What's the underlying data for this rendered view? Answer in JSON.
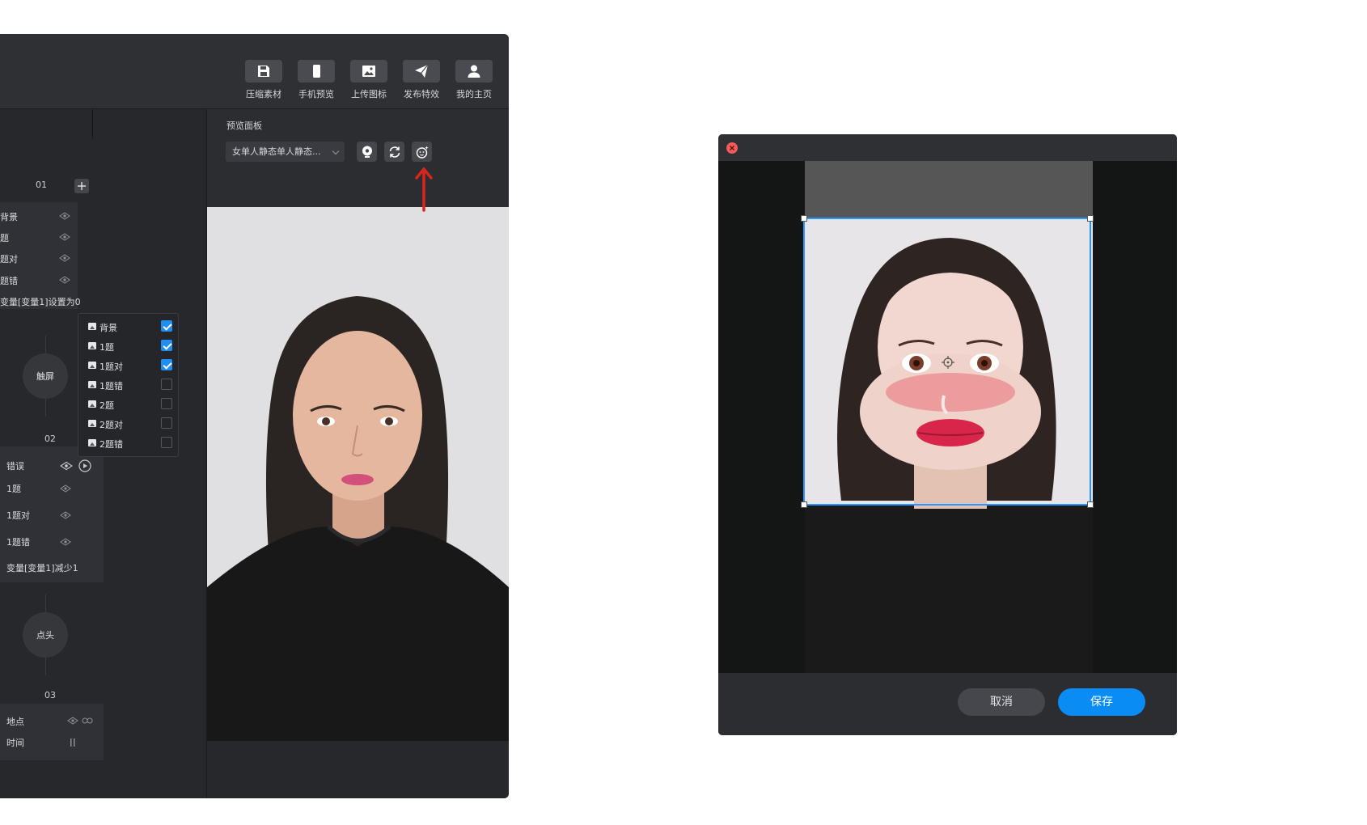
{
  "toolbar": {
    "items": [
      {
        "label": "压缩素材",
        "icon": "save-icon"
      },
      {
        "label": "手机预览",
        "icon": "phone-icon"
      },
      {
        "label": "上传图标",
        "icon": "image-upload-icon"
      },
      {
        "label": "发布特效",
        "icon": "send-icon"
      },
      {
        "label": "我的主页",
        "icon": "user-icon"
      }
    ]
  },
  "timeline": {
    "step1": {
      "number": "01",
      "rows": [
        "背景",
        "题",
        "题对",
        "题错",
        "变量[变量1]设置为0"
      ]
    },
    "trigger1": "触屏",
    "step2": {
      "number": "02",
      "rows": [
        "错误",
        "1题",
        "1题对",
        "1题错",
        "变量[变量1]减少1"
      ]
    },
    "trigger2": "点头",
    "step3": {
      "number": "03",
      "rows": [
        "地点",
        "时间"
      ]
    }
  },
  "layer_popup": {
    "items": [
      {
        "label": "背景",
        "checked": true
      },
      {
        "label": "1题",
        "checked": true
      },
      {
        "label": "1题对",
        "checked": true
      },
      {
        "label": "1题错",
        "checked": false
      },
      {
        "label": "2题",
        "checked": false
      },
      {
        "label": "2题对",
        "checked": false
      },
      {
        "label": "2题错",
        "checked": false
      }
    ]
  },
  "preview": {
    "title": "预览面板",
    "model_select": "女单人静态单人静态...",
    "buttons": [
      "camera-icon",
      "refresh-icon",
      "face-icon"
    ]
  },
  "dialog": {
    "cancel_label": "取消",
    "save_label": "保存"
  },
  "colors": {
    "accent": "#0a8cf5",
    "annotation_arrow": "#d9261c",
    "close": "#f35a5a"
  }
}
